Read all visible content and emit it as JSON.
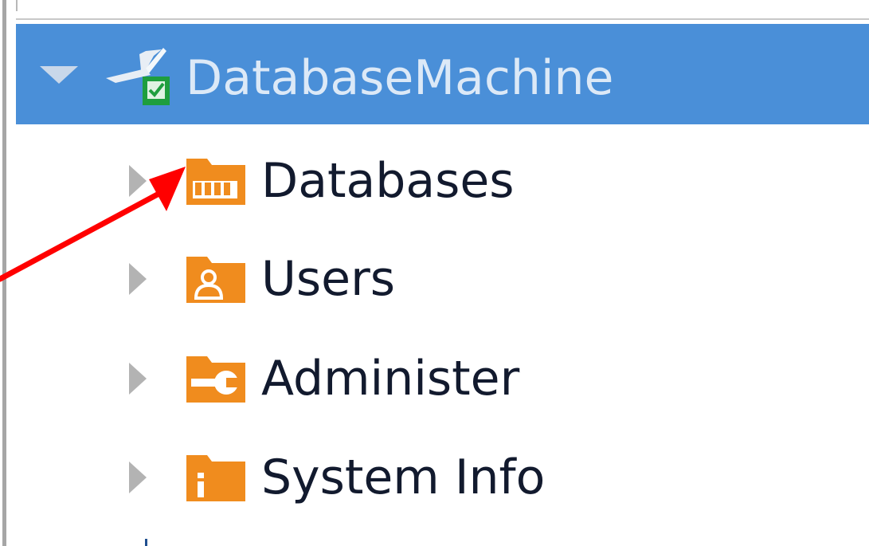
{
  "tree": {
    "root": {
      "label": "DatabaseMachine",
      "state": "expanded",
      "icon": "database-machine-icon",
      "status_icon": "green-check-icon"
    },
    "items": [
      {
        "label": "Databases",
        "icon": "databases-folder-icon",
        "state": "collapsed"
      },
      {
        "label": "Users",
        "icon": "users-folder-icon",
        "state": "collapsed"
      },
      {
        "label": "Administer",
        "icon": "administer-folder-icon",
        "state": "collapsed"
      },
      {
        "label": "System Info",
        "icon": "system-info-folder-icon",
        "state": "collapsed"
      }
    ]
  },
  "annotation": {
    "type": "arrow",
    "color": "#ff0000",
    "target": "Databases"
  },
  "colors": {
    "selection": "#4a8fd8",
    "folder": "#f08c1e",
    "status_ok": "#1e9e3e"
  }
}
